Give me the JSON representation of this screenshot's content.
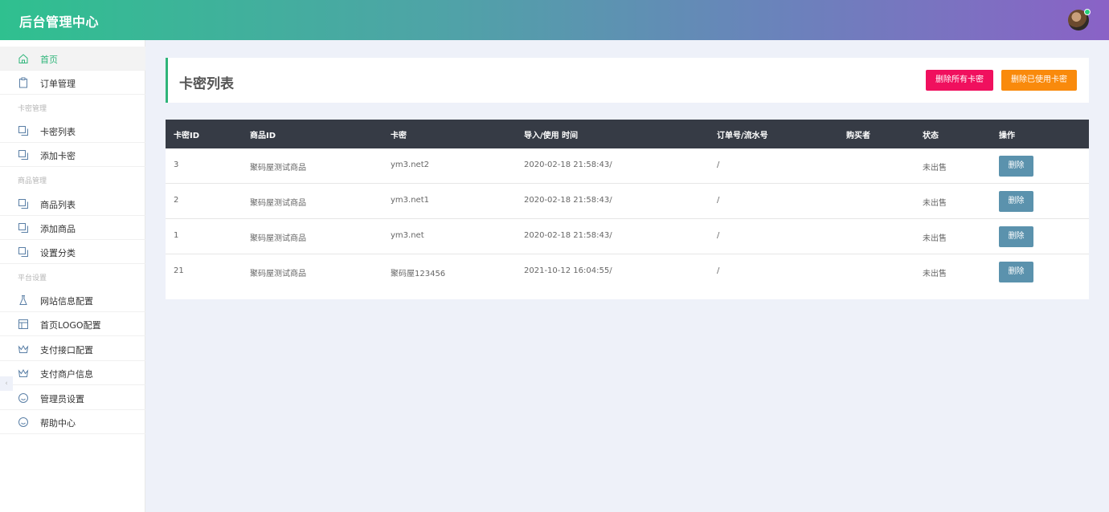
{
  "header": {
    "brand": "后台管理中心"
  },
  "sidebar": {
    "items": [
      {
        "label": "首页",
        "icon": "home-icon",
        "active": true
      },
      {
        "label": "订单管理",
        "icon": "clipboard-icon"
      }
    ],
    "groups": [
      {
        "title": "卡密管理",
        "items": [
          {
            "label": "卡密列表",
            "icon": "copy-icon"
          },
          {
            "label": "添加卡密",
            "icon": "copy-icon"
          }
        ]
      },
      {
        "title": "商品管理",
        "items": [
          {
            "label": "商品列表",
            "icon": "copy-icon"
          },
          {
            "label": "添加商品",
            "icon": "copy-icon"
          },
          {
            "label": "设置分类",
            "icon": "copy-icon"
          }
        ]
      },
      {
        "title": "平台设置",
        "items": [
          {
            "label": "网站信息配置",
            "icon": "flask-icon"
          },
          {
            "label": "首页LOGO配置",
            "icon": "layout-icon"
          },
          {
            "label": "支付接口配置",
            "icon": "crown-icon"
          },
          {
            "label": "支付商户信息",
            "icon": "crown-icon"
          },
          {
            "label": "管理员设置",
            "icon": "smile-icon"
          },
          {
            "label": "帮助中心",
            "icon": "smile-icon"
          }
        ]
      }
    ]
  },
  "page": {
    "title": "卡密列表",
    "btn_delete_all": "删除所有卡密",
    "btn_delete_used": "删除已使用卡密"
  },
  "table": {
    "columns": [
      "卡密ID",
      "商品ID",
      "卡密",
      "导入/使用 时间",
      "订单号/流水号",
      "购买者",
      "状态",
      "操作"
    ],
    "rows": [
      {
        "id": "3",
        "product": "聚码屋测试商品",
        "card": "ym3.net2",
        "time": "2020-02-18 21:58:43/",
        "order": "/",
        "buyer": "",
        "status": "未出售",
        "action": "删除"
      },
      {
        "id": "2",
        "product": "聚码屋测试商品",
        "card": "ym3.net1",
        "time": "2020-02-18 21:58:43/",
        "order": "/",
        "buyer": "",
        "status": "未出售",
        "action": "删除"
      },
      {
        "id": "1",
        "product": "聚码屋测试商品",
        "card": "ym3.net",
        "time": "2020-02-18 21:58:43/",
        "order": "/",
        "buyer": "",
        "status": "未出售",
        "action": "删除"
      },
      {
        "id": "21",
        "product": "聚码屋测试商品",
        "card": "聚码屋123456",
        "time": "2021-10-12 16:04:55/",
        "order": "/",
        "buyer": "",
        "status": "未出售",
        "action": "删除"
      }
    ]
  },
  "colors": {
    "accent": "#2fb57a",
    "danger": "#f0105e",
    "warning": "#f98a0c",
    "table_header": "#363b45",
    "row_button": "#5b92ad"
  }
}
